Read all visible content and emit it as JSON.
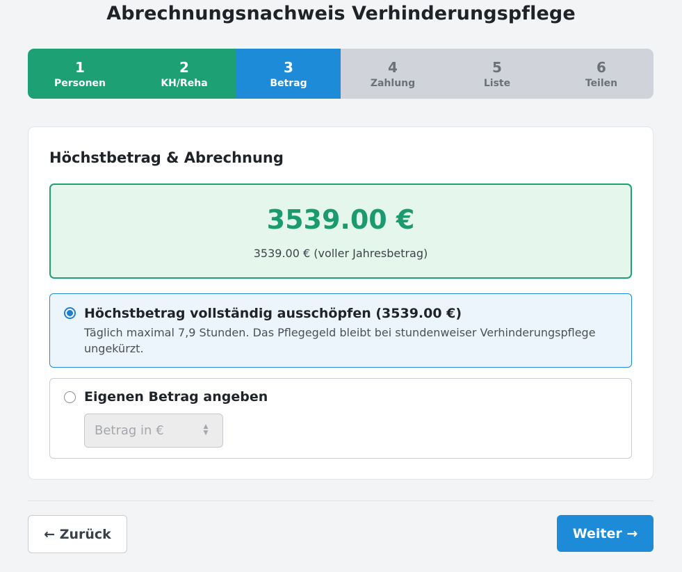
{
  "page_title": "Abrechnungsnachweis Verhinderungspflege",
  "steps": [
    {
      "number": "1",
      "label": "Personen",
      "state": "done"
    },
    {
      "number": "2",
      "label": "KH/Reha",
      "state": "done"
    },
    {
      "number": "3",
      "label": "Betrag",
      "state": "active"
    },
    {
      "number": "4",
      "label": "Zahlung",
      "state": "todo"
    },
    {
      "number": "5",
      "label": "Liste",
      "state": "todo"
    },
    {
      "number": "6",
      "label": "Teilen",
      "state": "todo"
    }
  ],
  "card": {
    "title": "Höchstbetrag & Abrechnung",
    "amount": "3539.00 €",
    "amount_note": "3539.00 € (voller Jahresbetrag)"
  },
  "options": {
    "max": {
      "title": "Höchstbetrag vollständig ausschöpfen (3539.00 €)",
      "description": "Täglich maximal 7,9 Stunden. Das Pflegegeld bleibt bei stundenweiser Verhinderungspflege ungekürzt.",
      "selected": true
    },
    "custom": {
      "title": "Eigenen Betrag angeben",
      "input_placeholder": "Betrag in €",
      "input_value": "",
      "selected": false
    }
  },
  "nav": {
    "back_label": "← Zurück",
    "next_label": "Weiter →"
  },
  "colors": {
    "done": "#1ea075",
    "active": "#1d8bd8",
    "todo": "#d0d4da",
    "amount_text": "#1c9a6f",
    "amount_bg": "#e5f6ec"
  }
}
